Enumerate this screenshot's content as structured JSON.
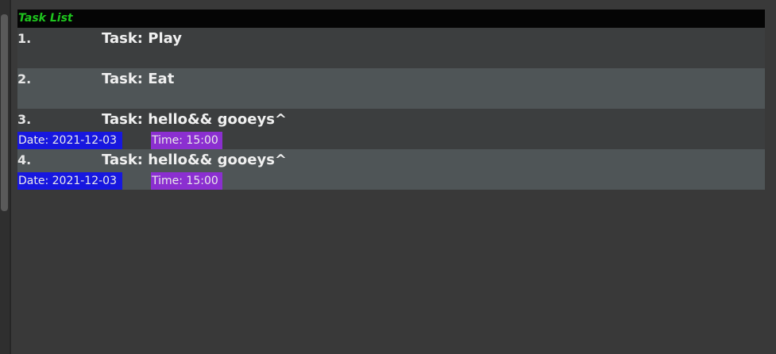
{
  "header": {
    "title": "Task List"
  },
  "colors": {
    "header_title": "#1ec51e",
    "date_tag": "#1717df",
    "time_tag": "#8b2fd0",
    "row_odd": "#3c3e3f",
    "row_even": "#4f5557",
    "background": "#393939"
  },
  "tasks": [
    {
      "index": "1.",
      "title": "Task: Play"
    },
    {
      "index": "2.",
      "title": "Task: Eat"
    },
    {
      "index": "3.",
      "title": "Task: hello&& gooeys^",
      "date": "Date: 2021-12-03",
      "time": "Time: 15:00"
    },
    {
      "index": "4.",
      "title": "Task: hello&& gooeys^",
      "date": "Date: 2021-12-03",
      "time": "Time: 15:00"
    }
  ]
}
